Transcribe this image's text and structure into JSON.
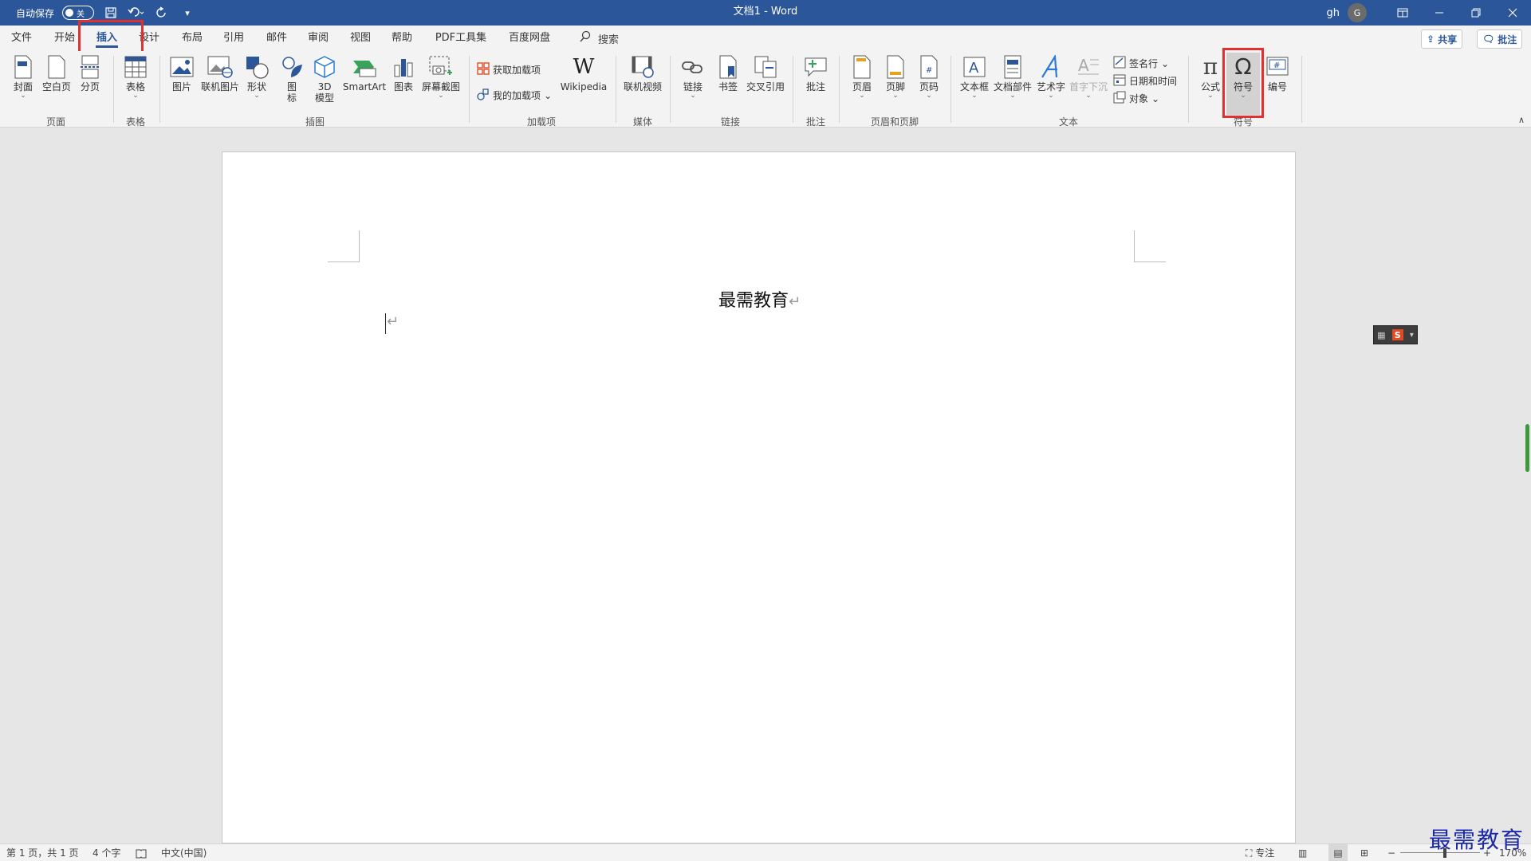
{
  "titlebar": {
    "autosave_label": "自动保存",
    "autosave_state": "关",
    "doc_title": "文档1  -  Word",
    "user": "gh",
    "avatar_letter": "G"
  },
  "tabs": [
    "文件",
    "开始",
    "插入",
    "设计",
    "布局",
    "引用",
    "邮件",
    "审阅",
    "视图",
    "帮助",
    "PDF工具集",
    "百度网盘"
  ],
  "search_label": "搜索",
  "share_label": "共享",
  "comment_label": "批注",
  "ribbon": {
    "page_group": {
      "label": "页面",
      "cover": "封面",
      "blank": "空白页",
      "break": "分页"
    },
    "table_group": {
      "label": "表格",
      "table": "表格"
    },
    "illus_group": {
      "label": "插图",
      "picture": "图片",
      "online_picture": "联机图片",
      "shapes": "形状",
      "icons_1": "图",
      "icons_2": "标",
      "model3d_1": "3D",
      "model3d_2": "模型",
      "smartart": "SmartArt",
      "chart": "图表",
      "screenshot": "屏幕截图"
    },
    "addins_group": {
      "label": "加载项",
      "get": "获取加载项",
      "my": "我的加载项",
      "wikipedia": "Wikipedia"
    },
    "media_group": {
      "label": "媒体",
      "video": "联机视频"
    },
    "links_group": {
      "label": "链接",
      "link": "链接",
      "bookmark": "书签",
      "crossref": "交叉引用"
    },
    "comment_group": {
      "label": "批注",
      "comment": "批注"
    },
    "hf_group": {
      "label": "页眉和页脚",
      "header": "页眉",
      "footer": "页脚",
      "pagenum": "页码"
    },
    "text_group": {
      "label": "文本",
      "textbox": "文本框",
      "quickparts": "文档部件",
      "wordart": "艺术字",
      "dropcap": "首字下沉",
      "signature": "签名行",
      "datetime": "日期和时间",
      "object": "对象"
    },
    "symbols_group": {
      "label": "符号",
      "equation": "公式",
      "symbol": "符号",
      "number": "编号"
    }
  },
  "document": {
    "title": "最需教育"
  },
  "statusbar": {
    "page": "第 1 页，共 1 页",
    "words": "4 个字",
    "language": "中文(中国)",
    "focus": "专注",
    "zoom": "170%"
  },
  "watermark": "最需教育"
}
